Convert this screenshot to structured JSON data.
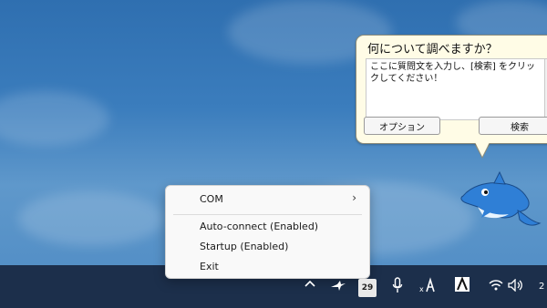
{
  "assistant": {
    "title": "何について調べますか？",
    "prompt": "ここに質問文を入力し、[検索] をクリックしてください！",
    "options_button": "オプション",
    "search_button": "検索",
    "background_color": "#fffce6"
  },
  "context_menu": {
    "items": [
      {
        "label": "COM",
        "has_submenu": true
      },
      {
        "label": "Auto-connect (Enabled)"
      },
      {
        "label": "Startup (Enabled)"
      },
      {
        "label": "Exit"
      }
    ]
  },
  "taskbar": {
    "tray_icons": [
      "chevron-up-icon",
      "bird-app-icon",
      "badge-29",
      "microphone-icon",
      "x-a-app-icon",
      "a-app-icon",
      "wifi-icon",
      "speaker-icon"
    ],
    "badge_value": "29",
    "clock_partial": "2",
    "color": "#1c2f4b"
  }
}
